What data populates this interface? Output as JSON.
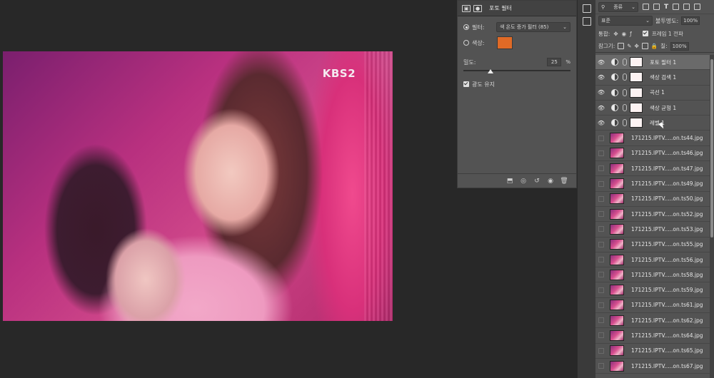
{
  "canvas": {
    "watermark": "KBS2"
  },
  "properties_panel": {
    "title": "포토 필터",
    "filter_label": "필터:",
    "filter_value": "색 온도 증가 필터 (85)",
    "color_label": "색상:",
    "color_swatch": "#e06a26",
    "density_label": "밀도:",
    "density_value": "25",
    "density_unit": "%",
    "density_level": 25,
    "preserve_luminosity_label": "광도 유지"
  },
  "layers_panel": {
    "kind_label": "종류",
    "blend_mode": "표준",
    "opacity_label": "불투명도:",
    "opacity_value": "100%",
    "unify_label": "통합:",
    "frame_propagate_label": "프레임 1 전파",
    "lock_label": "잠그기:",
    "fill_label": "칠:",
    "fill_value": "100%",
    "adjustment_layers": [
      {
        "name": "포토 필터 1",
        "selected": true
      },
      {
        "name": "색상 검색 1",
        "selected": false
      },
      {
        "name": "곡선 1",
        "selected": false
      },
      {
        "name": "색상 균형 1",
        "selected": false
      },
      {
        "name": "레벨 1",
        "selected": false
      }
    ],
    "image_layers": [
      "171215.IPTV.....on.ts44.jpg",
      "171215.IPTV.....on.ts46.jpg",
      "171215.IPTV.....on.ts47.jpg",
      "171215.IPTV.....on.ts49.jpg",
      "171215.IPTV.....on.ts50.jpg",
      "171215.IPTV.....on.ts52.jpg",
      "171215.IPTV.....on.ts53.jpg",
      "171215.IPTV.....on.ts55.jpg",
      "171215.IPTV.....on.ts56.jpg",
      "171215.IPTV.....on.ts58.jpg",
      "171215.IPTV.....on.ts59.jpg",
      "171215.IPTV.....on.ts61.jpg",
      "171215.IPTV.....on.ts62.jpg",
      "171215.IPTV.....on.ts64.jpg",
      "171215.IPTV.....on.ts65.jpg",
      "171215.IPTV.....on.ts67.jpg"
    ]
  }
}
